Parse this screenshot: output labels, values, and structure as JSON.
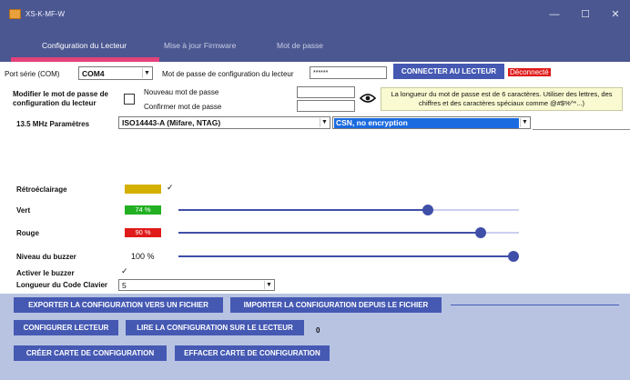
{
  "window": {
    "title": "XS-K-MF-W",
    "minimize": "—",
    "maximize": "☐",
    "close": "✕"
  },
  "tabs": [
    {
      "label": "Configuration du Lecteur"
    },
    {
      "label": "Mise à jour Firmware"
    },
    {
      "label": "Mot de passe"
    }
  ],
  "connection": {
    "port_label": "Port série (COM)",
    "port_value": "COM4",
    "password_label": "Mot de passe de configuration du lecteur",
    "password_value": "******",
    "connect_button": "CONNECTER AU LECTEUR",
    "status": "Déconnecté"
  },
  "password_change": {
    "label": "Modifier le mot de passe de configuration du lecteur",
    "new_label": "Nouveau mot de passe",
    "confirm_label": "Confirmer mot de passe",
    "info": "La longueur du mot de passe est de 6 caractères. Utiliser des lettres, des chiffres et des caractères spéciaux comme @#$%^*...)"
  },
  "mhz": {
    "label": "13.5 MHz Paramètres",
    "protocol": "ISO14443-A (Mifare, NTAG)",
    "mode": "CSN, no encryption"
  },
  "backlight": {
    "label": "Rétroéclairage",
    "color": "#d4b000",
    "checked": "✓"
  },
  "green": {
    "label": "Vert",
    "value_text": "74 %",
    "percent": 74,
    "color": "#22b022"
  },
  "red": {
    "label": "Rouge",
    "value_text": "90 %",
    "percent": 90,
    "color": "#e11a1a"
  },
  "buzzer_level": {
    "label": "Niveau du buzzer",
    "value_text": "100 %",
    "percent": 100
  },
  "buzzer_enable": {
    "label": "Activer le buzzer",
    "checked": "✓"
  },
  "keypad_length": {
    "label": "Longueur du Code Clavier",
    "value": "5"
  },
  "actions": {
    "export": "EXPORTER LA CONFIGURATION VERS UN FICHIER",
    "import": "IMPORTER LA CONFIGURATION DEPUIS LE FICHIER",
    "configure": "CONFIGURER LECTEUR",
    "read": "LIRE LA CONFIGURATION SUR LE LECTEUR",
    "read_count": "0",
    "create_card": "CRÉER CARTE DE CONFIGURATION",
    "erase_card": "EFFACER CARTE DE CONFIGURATION"
  },
  "colors": {
    "titlebar": "#4b5790",
    "accent": "#4559b3",
    "tab_underline": "#e3427a",
    "bottom_panel": "#b8c3e2"
  }
}
